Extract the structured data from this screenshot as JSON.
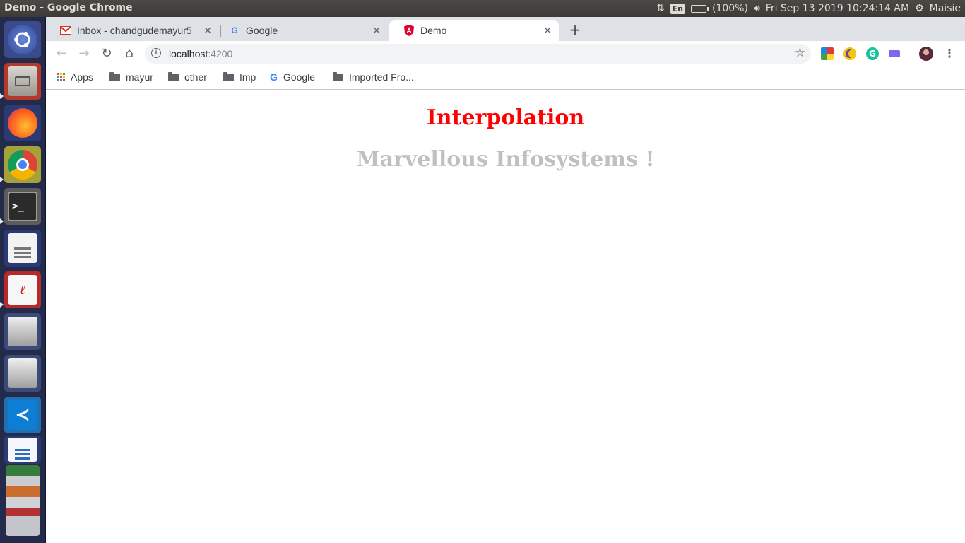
{
  "window": {
    "title": "Demo - Google Chrome"
  },
  "tray": {
    "input_lang": "En",
    "battery": "(100%)",
    "datetime": "Fri Sep 13 2019 10:24:14 AM",
    "user": "Maisie"
  },
  "tabs": [
    {
      "label": "Inbox - chandgudemayur5",
      "favicon": "gmail-icon",
      "active": false
    },
    {
      "label": "Google",
      "favicon": "google-icon",
      "active": false
    },
    {
      "label": "Demo",
      "favicon": "angular-icon",
      "active": true
    }
  ],
  "omnibox": {
    "host": "localhost",
    "port": ":4200"
  },
  "bookmarks": [
    {
      "label": "Apps",
      "icon": "apps-grid-icon"
    },
    {
      "label": "mayur",
      "icon": "folder-icon"
    },
    {
      "label": "other",
      "icon": "folder-icon"
    },
    {
      "label": "Imp",
      "icon": "folder-icon"
    },
    {
      "label": "Google",
      "icon": "google-icon"
    },
    {
      "label": "Imported Fro...",
      "icon": "folder-icon"
    }
  ],
  "page": {
    "heading": "Interpolation",
    "subheading": "Marvellous Infosystems !",
    "heading_color": "#ff0000",
    "subheading_color": "#c0c0c0"
  },
  "launcher": {
    "icons": [
      "ubuntu-dash-icon",
      "files-icon",
      "firefox-icon",
      "chrome-icon",
      "terminal-icon",
      "text-editor-icon",
      "pdf-viewer-icon",
      "drive-icon",
      "drive-icon",
      "vscode-icon",
      "libreoffice-writer-icon"
    ]
  }
}
